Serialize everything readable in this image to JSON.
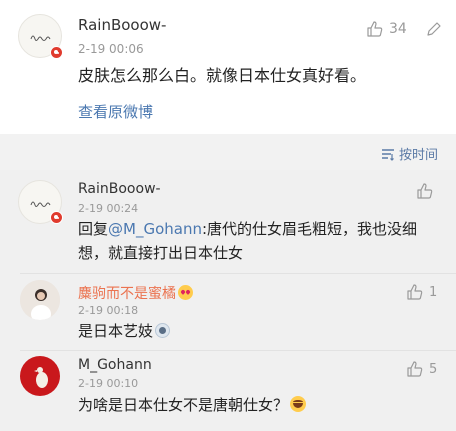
{
  "original_post": {
    "username": "RainBooow-",
    "time": "2-19 00:06",
    "like_count": "34",
    "text": "皮肤怎么那么白。就像日本仕女真好看。",
    "view_original": "查看原微博"
  },
  "sort": {
    "label": "按时间",
    "icon": "sort-lines-icon"
  },
  "replies": [
    {
      "username": "RainBooow-",
      "time": "2-19 00:24",
      "like_count": "",
      "reply_prefix": "回复",
      "mention": "@M_Gohann",
      "text_line1": ":唐代的仕女眉毛粗短，我也没细",
      "text_line2": "想，就直接打出日本仕女"
    },
    {
      "username": "麋驹而不是蜜橘",
      "time": "2-19 00:18",
      "like_count": "1",
      "text": "是日本艺妓"
    },
    {
      "username": "M_Gohann",
      "time": "2-19 00:10",
      "like_count": "5",
      "text": "为啥是日本仕女不是唐朝仕女？"
    }
  ],
  "colors": {
    "link": "#4b78b0",
    "vip_name": "#eb7350",
    "background": "#f2f2f2"
  }
}
